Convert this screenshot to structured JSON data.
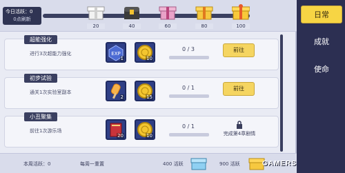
{
  "header": {
    "today_activity_label": "今日活跃：0",
    "refresh_label": "0点刷新",
    "activity_progress": 0,
    "chests": [
      {
        "value": "20",
        "icon": "white-gift-box-icon"
      },
      {
        "value": "40",
        "icon": "gold-chest-icon"
      },
      {
        "value": "60",
        "icon": "pink-gift-box-icon"
      },
      {
        "value": "80",
        "icon": "gold-gift-box-icon"
      },
      {
        "value": "100",
        "icon": "gold-big-gift-icon"
      }
    ]
  },
  "tasks": [
    {
      "title": "超能强化",
      "desc": "进行3次超能力强化",
      "rewards": [
        {
          "icon": "exp-card-icon",
          "count": "1"
        },
        {
          "icon": "gold-coin-icon",
          "count": "10"
        }
      ],
      "progress": "0 / 3",
      "progress_fraction": 0,
      "action": "前往"
    },
    {
      "title": "初步试验",
      "desc": "通关1次实验室副本",
      "rewards": [
        {
          "icon": "popsicle-icon",
          "count": "2"
        },
        {
          "icon": "gold-coin-icon",
          "count": "15"
        }
      ],
      "progress": "0 / 1",
      "progress_fraction": 0,
      "action": "前往"
    },
    {
      "title": "小丑聚集",
      "desc": "前往1次游乐场",
      "rewards": [
        {
          "icon": "red-book-icon",
          "count": "20"
        },
        {
          "icon": "gold-coin-icon",
          "count": "10"
        }
      ],
      "progress": "0 / 1",
      "progress_fraction": 0,
      "locked_text": "完成第4章剧情"
    }
  ],
  "footer": {
    "week_activity": "本周活跃：0",
    "weekly_reset": "每周一重置",
    "chest_400": "400 活跃",
    "chest_900": "900 活跃"
  },
  "sidebar": {
    "items": [
      {
        "label": "日常",
        "active": true
      },
      {
        "label": "成就",
        "active": false
      },
      {
        "label": "使命",
        "active": false
      }
    ]
  },
  "watermark": "GAMERS"
}
